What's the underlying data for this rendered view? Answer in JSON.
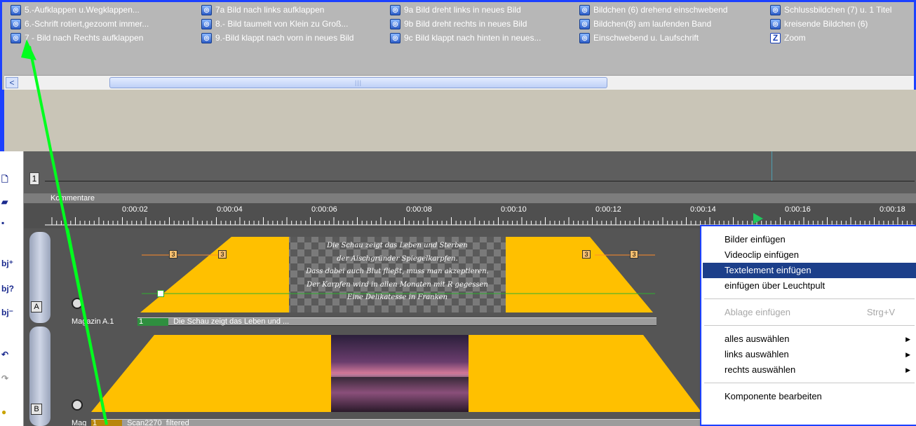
{
  "effects": [
    {
      "label": "5.-Aufklappen u.Wegklappen..."
    },
    {
      "label": "6.-Schrift rotiert,gezoomt immer..."
    },
    {
      "label": "7 - Bild nach Rechts aufklappen"
    },
    {
      "label": "7a Bild nach links aufklappen"
    },
    {
      "label": "8.- Bild taumelt von Klein zu Groß..."
    },
    {
      "label": "9.-Bild klappt nach vorn in neues Bild"
    },
    {
      "label": "9a Bild dreht links in neues Bild"
    },
    {
      "label": "9b Bild dreht rechts in neues Bild"
    },
    {
      "label": "9c Bild klappt nach hinten in neues..."
    },
    {
      "label": "Bildchen (6) drehend einschwebend"
    },
    {
      "label": "Bildchen(8) am laufenden Band"
    },
    {
      "label": "Einschwebend u. Laufschrift"
    },
    {
      "label": "Schlussbildchen (7) u. 1 Titel"
    },
    {
      "label": "kreisende Bildchen (6)"
    },
    {
      "label": "Zoom"
    }
  ],
  "scroll": {
    "left_arrow": "<",
    "grip": "|||"
  },
  "track_numbers": {
    "comment": "1",
    "a": "A",
    "b": "B"
  },
  "comment_label": "Kommentare",
  "ruler_labels": [
    "0:00:02",
    "0:00:04",
    "0:00:06",
    "0:00:08",
    "0:00:10",
    "0:00:12",
    "0:00:14",
    "0:00:16",
    "0:00:18"
  ],
  "keyframe_label": "3",
  "text_overlay": [
    "Die Schau zeigt das Leben und Sterben",
    "der Aischgründer Spiegelkarpfen.",
    "Dass dabei auch Blut fließt, muss man akzeptieren.",
    "Der Karpfen wird in allen Monaten mit R gegessen",
    "Eine Delikatesse in Franken"
  ],
  "track_a": {
    "name": "Magazin A.1",
    "clip_num": "1",
    "clip_title": "Die Schau zeigt das Leben und ..."
  },
  "track_b": {
    "name": "Mag",
    "clip_num": "1",
    "clip_title": "Scan2270_filtered"
  },
  "context_menu": {
    "items": [
      {
        "label": "Bilder einfügen"
      },
      {
        "label": "Videoclip einfügen"
      },
      {
        "label": "Textelement einfügen",
        "selected": true
      },
      {
        "label": "einfügen über Leuchtpult"
      },
      {
        "label": "Ablage einfügen",
        "shortcut": "Strg+V",
        "disabled": true
      },
      {
        "label": "alles auswählen",
        "submenu": true
      },
      {
        "label": "links auswählen",
        "submenu": true
      },
      {
        "label": "rechts auswählen",
        "submenu": true
      },
      {
        "label": "Komponente bearbeiten"
      }
    ]
  },
  "toolbar_icons": [
    "new-file-icon",
    "open-folder-icon",
    "save-icon",
    "add-object-icon",
    "object-help-icon",
    "remove-object-icon",
    "undo-icon",
    "redo-icon",
    "color-icon"
  ],
  "colors": {
    "accent": "#1c41ff",
    "clip": "#ffc000",
    "menu_highlight": "#1c3f8a",
    "arrow": "#00ff1e",
    "play": "#22c55e"
  }
}
